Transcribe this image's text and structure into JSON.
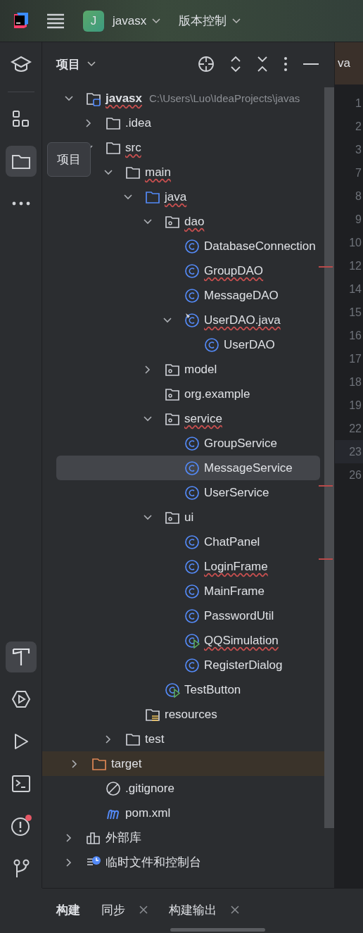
{
  "topbar": {
    "project_badge": "J",
    "project": "javasx",
    "vcs": "版本控制"
  },
  "side_tools": [
    {
      "kind": "learn",
      "selected": false
    },
    {
      "kind": "structure",
      "selected": false
    },
    {
      "kind": "project",
      "selected": true
    },
    {
      "kind": "more",
      "selected": false
    }
  ],
  "side_tools_bottom": [
    {
      "kind": "build",
      "selected": true
    },
    {
      "kind": "services",
      "selected": false
    },
    {
      "kind": "run",
      "selected": false
    },
    {
      "kind": "terminal",
      "selected": false
    },
    {
      "kind": "problems",
      "selected": false,
      "badge": true
    },
    {
      "kind": "git",
      "selected": false
    }
  ],
  "tooltip": "项目",
  "panel": {
    "title": "项目"
  },
  "tree": [
    {
      "kind": "project",
      "name": "javasx",
      "path": "C:\\Users\\Luo\\IdeaProjects\\javas",
      "expanded": true,
      "selected": false,
      "error": true,
      "children": [
        {
          "kind": "folder",
          "name": ".idea",
          "expanded": false,
          "selected": false,
          "error": false
        },
        {
          "kind": "folder",
          "name": "src",
          "expanded": true,
          "selected": false,
          "error": true,
          "children": [
            {
              "kind": "folder",
              "name": "main",
              "expanded": true,
              "selected": false,
              "error": true,
              "children": [
                {
                  "kind": "source",
                  "name": "java",
                  "expanded": true,
                  "selected": false,
                  "error": true,
                  "children": [
                    {
                      "kind": "package",
                      "name": "dao",
                      "expanded": true,
                      "selected": false,
                      "error": true,
                      "children": [
                        {
                          "kind": "class",
                          "name": "DatabaseConnection",
                          "selected": false,
                          "error": false
                        },
                        {
                          "kind": "class",
                          "name": "GroupDAO",
                          "selected": false,
                          "error": true
                        },
                        {
                          "kind": "class",
                          "name": "MessageDAO",
                          "selected": false,
                          "error": false
                        },
                        {
                          "kind": "file",
                          "name": "UserDAO.java",
                          "expanded": true,
                          "selected": false,
                          "error": true,
                          "children": [
                            {
                              "kind": "class",
                              "name": "UserDAO",
                              "selected": false,
                              "error": false
                            }
                          ]
                        }
                      ]
                    },
                    {
                      "kind": "package",
                      "name": "model",
                      "expanded": false,
                      "selected": false,
                      "error": false
                    },
                    {
                      "kind": "package",
                      "name": "org.example",
                      "selected": false,
                      "error": false
                    },
                    {
                      "kind": "package",
                      "name": "service",
                      "expanded": true,
                      "selected": false,
                      "error": true,
                      "children": [
                        {
                          "kind": "class",
                          "name": "GroupService",
                          "selected": false,
                          "error": false
                        },
                        {
                          "kind": "class",
                          "name": "MessageService",
                          "selected": true,
                          "error": false
                        },
                        {
                          "kind": "class",
                          "name": "UserService",
                          "selected": false,
                          "error": false
                        }
                      ]
                    },
                    {
                      "kind": "package",
                      "name": "ui",
                      "expanded": true,
                      "selected": false,
                      "error": false,
                      "children": [
                        {
                          "kind": "class",
                          "name": "ChatPanel",
                          "selected": false,
                          "error": false
                        },
                        {
                          "kind": "class",
                          "name": "LoginFrame",
                          "selected": false,
                          "error": true
                        },
                        {
                          "kind": "class",
                          "name": "MainFrame",
                          "selected": false,
                          "error": false
                        },
                        {
                          "kind": "class",
                          "name": "PasswordUtil",
                          "selected": false,
                          "error": false
                        },
                        {
                          "kind": "main",
                          "name": "QQSimulation",
                          "selected": false,
                          "error": true
                        },
                        {
                          "kind": "class",
                          "name": "RegisterDialog",
                          "selected": false,
                          "error": false
                        }
                      ]
                    },
                    {
                      "kind": "main",
                      "name": "TestButton",
                      "selected": false,
                      "error": false
                    }
                  ]
                },
                {
                  "kind": "resources",
                  "name": "resources",
                  "selected": false,
                  "error": false
                }
              ]
            },
            {
              "kind": "folder",
              "name": "test",
              "expanded": false,
              "selected": false,
              "error": false
            }
          ]
        },
        {
          "kind": "excluded",
          "name": "target",
          "expanded": false,
          "selected": false,
          "error": false
        },
        {
          "kind": "ignore",
          "name": ".gitignore",
          "selected": false,
          "error": false
        },
        {
          "kind": "maven",
          "name": "pom.xml",
          "selected": false,
          "error": false
        }
      ]
    },
    {
      "kind": "library",
      "name": "外部库",
      "expanded": false,
      "selected": false,
      "error": false
    },
    {
      "kind": "scratch",
      "name": "临时文件和控制台",
      "expanded": false,
      "selected": false,
      "error": false
    }
  ],
  "editor": {
    "tab": "va",
    "line_numbers": [
      {
        "text": "1",
        "selected": false
      },
      {
        "text": "2",
        "selected": false
      },
      {
        "text": "3",
        "selected": false
      },
      {
        "text": "7",
        "selected": false
      },
      {
        "text": "8",
        "selected": false
      },
      {
        "text": "9",
        "selected": false
      },
      {
        "text": "10",
        "selected": false
      },
      {
        "text": "12",
        "selected": false
      },
      {
        "text": "14",
        "selected": false
      },
      {
        "text": "15",
        "selected": false
      },
      {
        "text": "16",
        "selected": false
      },
      {
        "text": "17",
        "selected": false
      },
      {
        "text": "18",
        "selected": false
      },
      {
        "text": "19",
        "selected": false
      },
      {
        "text": "22",
        "selected": false
      },
      {
        "text": "23",
        "selected": true
      },
      {
        "text": "26",
        "selected": false
      }
    ]
  },
  "bottom_tabs": [
    {
      "label": "构建",
      "selected": true,
      "closable": false
    },
    {
      "label": "同步",
      "selected": false,
      "closable": true
    },
    {
      "label": "构建输出",
      "selected": false,
      "closable": true
    }
  ]
}
